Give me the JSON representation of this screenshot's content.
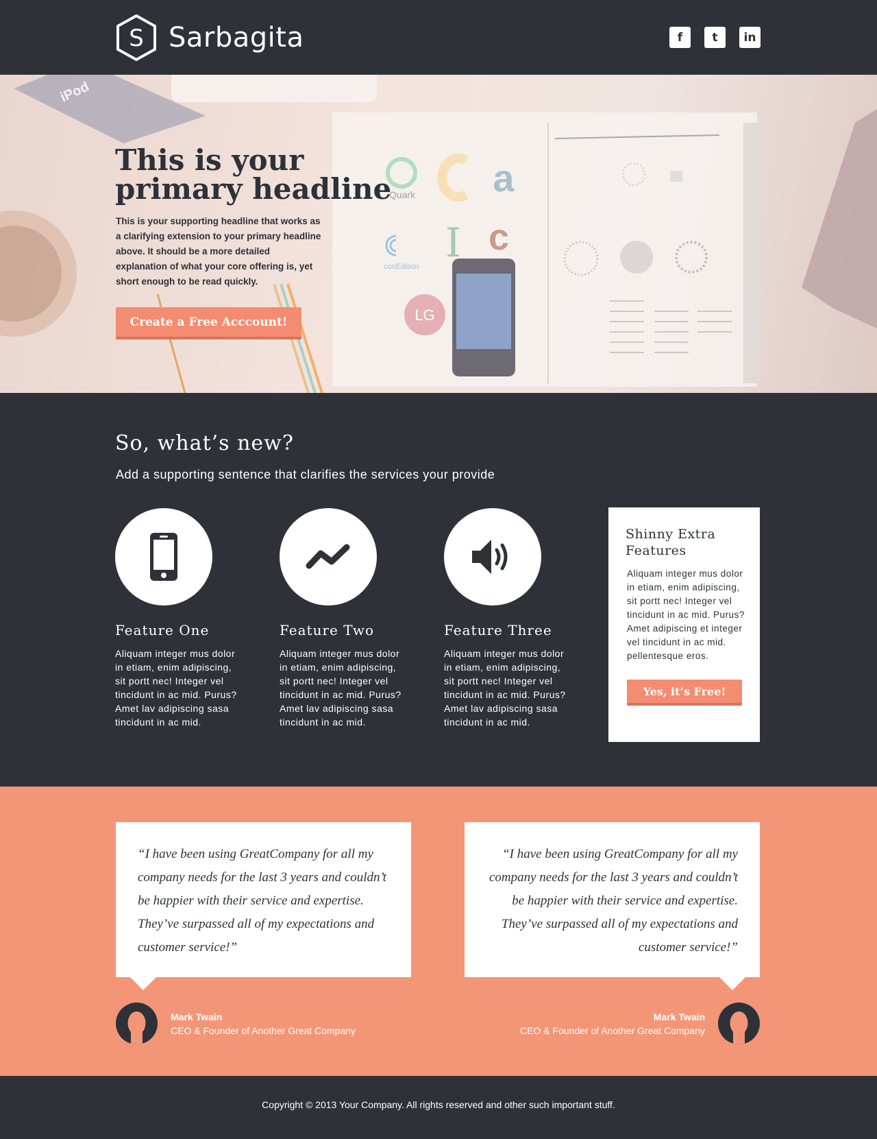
{
  "header": {
    "brand": "Sarbagita",
    "brand_letter": "S",
    "social": [
      {
        "label": "f",
        "icon": "facebook-icon"
      },
      {
        "label": "t",
        "icon": "twitter-icon"
      },
      {
        "label": "in",
        "icon": "linkedin-icon"
      }
    ]
  },
  "hero": {
    "headline": "This is your primary headline",
    "supporting": "This is your supporting headline that works as a clarifying extension to your primary headline above. It should be a more detailed explanation of what your core offering is, yet short enough to be read quickly.",
    "cta": "Create a Free Acccount!",
    "image_labels": [
      "iPod",
      "Quark",
      "conEdison"
    ]
  },
  "features": {
    "title": "So, what’s new?",
    "subtitle": "Add a supporting sentence that clarifies the services your provide",
    "items": [
      {
        "title": "Feature One",
        "text": "Aliquam integer mus dolor in etiam, enim adipiscing, sit portt nec! Integer vel tincidunt in ac mid. Purus? Amet lav adipiscing sasa tincidunt in ac mid.",
        "icon": "phone-icon"
      },
      {
        "title": "Feature Two",
        "text": "Aliquam integer mus dolor in etiam, enim adipiscing, sit portt nec! Integer vel tincidunt in ac mid. Purus? Amet lav adipiscing sasa tincidunt in ac mid.",
        "icon": "trend-icon"
      },
      {
        "title": "Feature Three",
        "text": "Aliquam integer mus dolor in etiam, enim adipiscing, sit portt nec! Integer vel tincidunt in ac mid. Purus? Amet lav adipiscing sasa tincidunt in ac mid.",
        "icon": "speaker-icon"
      }
    ],
    "extra": {
      "title": "Shinny Extra Features",
      "text": "Aliquam integer mus dolor in etiam, enim adipiscing, sit portt nec! Integer vel tincidunt in ac mid. Purus? Amet adipiscing et integer vel tincidunt in ac mid. pellentesque eros.",
      "button": "Yes, it’s Free!"
    }
  },
  "testimonials": [
    {
      "quote": "“I have been using GreatCompany for all my company needs for the last 3 years and couldn’t be happier with their service and expertise. They’ve surpassed all of my expectations and customer service!”",
      "name": "Mark Twain",
      "role": "CEO & Founder of Another Great Company"
    },
    {
      "quote": "“I have been using GreatCompany for all my company needs for the last 3 years and couldn’t be happier with their service and expertise. They’ve surpassed all of my expectations and customer service!”",
      "name": "Mark Twain",
      "role": "CEO & Founder of Another Great Company"
    }
  ],
  "footer": {
    "copyright": "Copyright © 2013 Your Company. All rights reserved and other such important stuff."
  },
  "colors": {
    "dark": "#2e3138",
    "accent": "#f48c71",
    "testimonial_bg": "#f39677"
  }
}
